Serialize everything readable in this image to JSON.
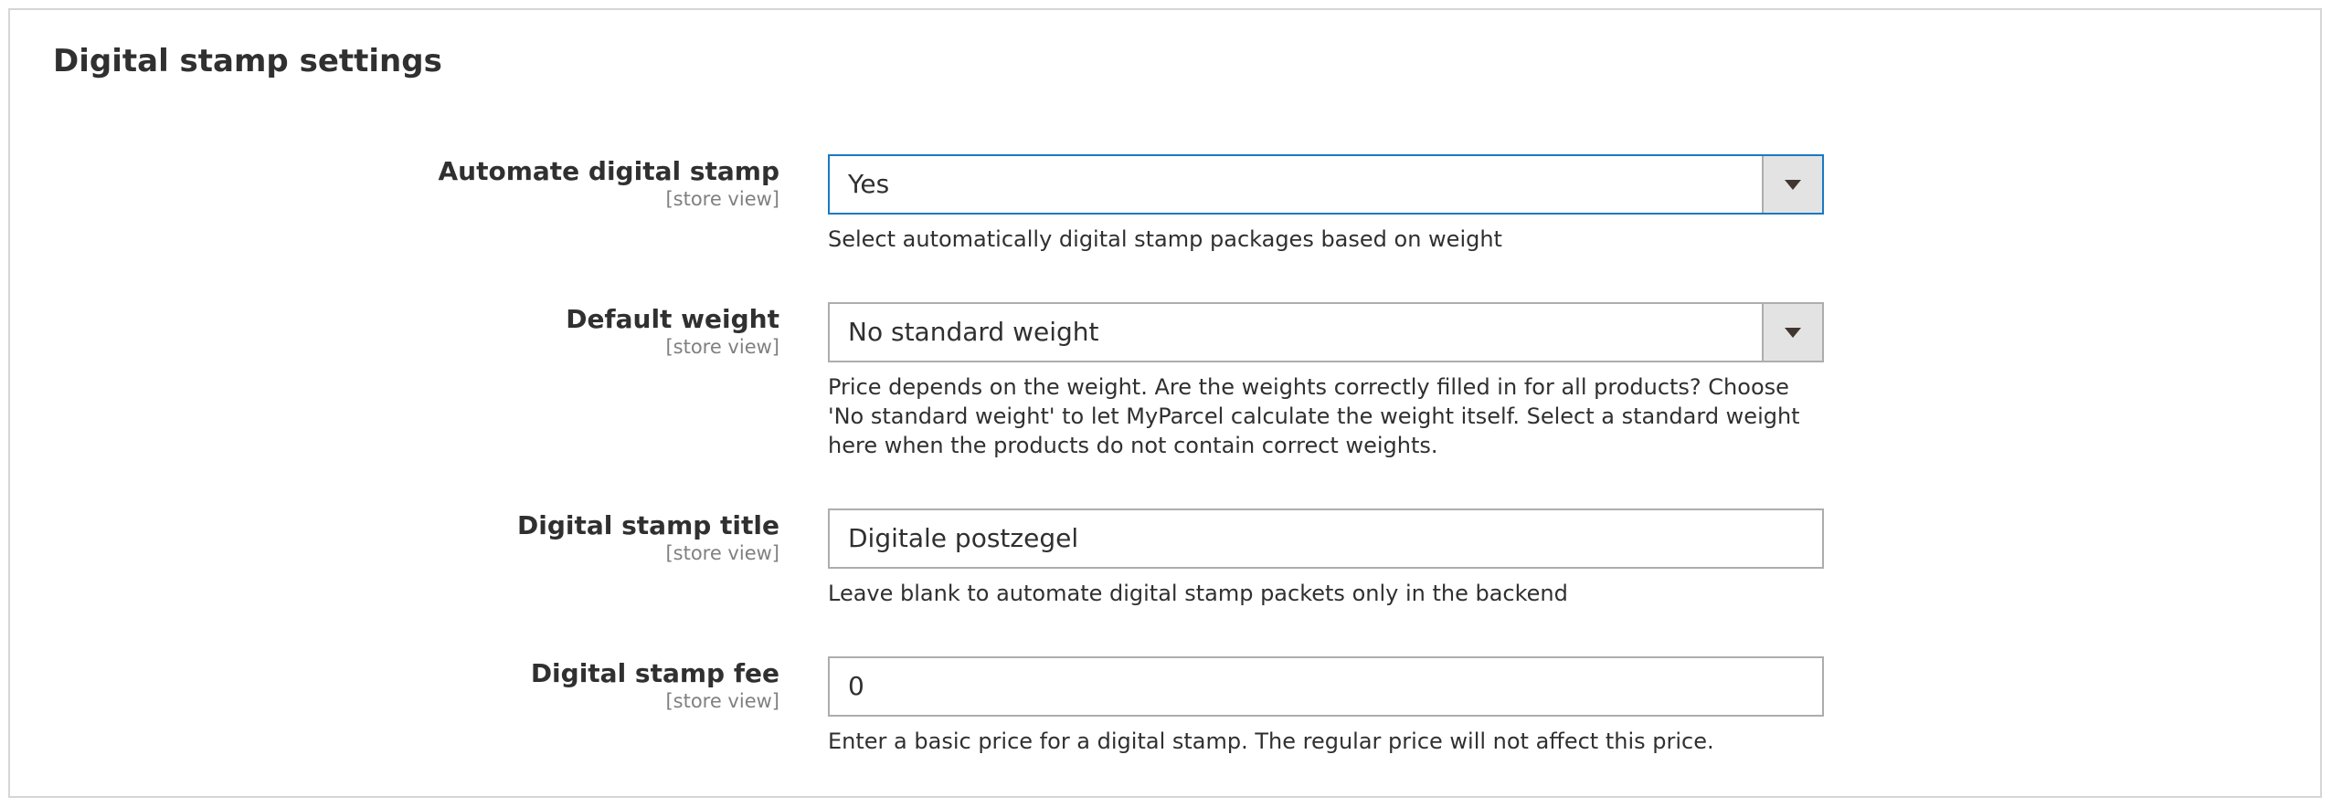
{
  "section": {
    "title": "Digital stamp settings"
  },
  "fields": [
    {
      "label": "Automate digital stamp",
      "scope": "[store view]",
      "type": "select",
      "value": "Yes",
      "note": "Select automatically digital stamp packages based on weight"
    },
    {
      "label": "Default weight",
      "scope": "[store view]",
      "type": "select",
      "value": "No standard weight",
      "note": "Price depends on the weight. Are the weights correctly filled in for all products? Choose 'No standard weight' to let MyParcel calculate the weight itself. Select a standard weight here when the products do not contain correct weights."
    },
    {
      "label": "Digital stamp title",
      "scope": "[store view]",
      "type": "text",
      "value": "Digitale postzegel",
      "note": "Leave blank to automate digital stamp packets only in the backend"
    },
    {
      "label": "Digital stamp fee",
      "scope": "[store view]",
      "type": "text",
      "value": "0",
      "note": "Enter a basic price for a digital stamp. The regular price will not affect this price."
    }
  ],
  "colors": {
    "focus_border": "#1979c3",
    "input_border": "#adadad",
    "select_button_bg": "#e3e3e3",
    "panel_border": "#d6d6d6"
  },
  "icons": {
    "dropdown": "chevron-down-icon"
  }
}
